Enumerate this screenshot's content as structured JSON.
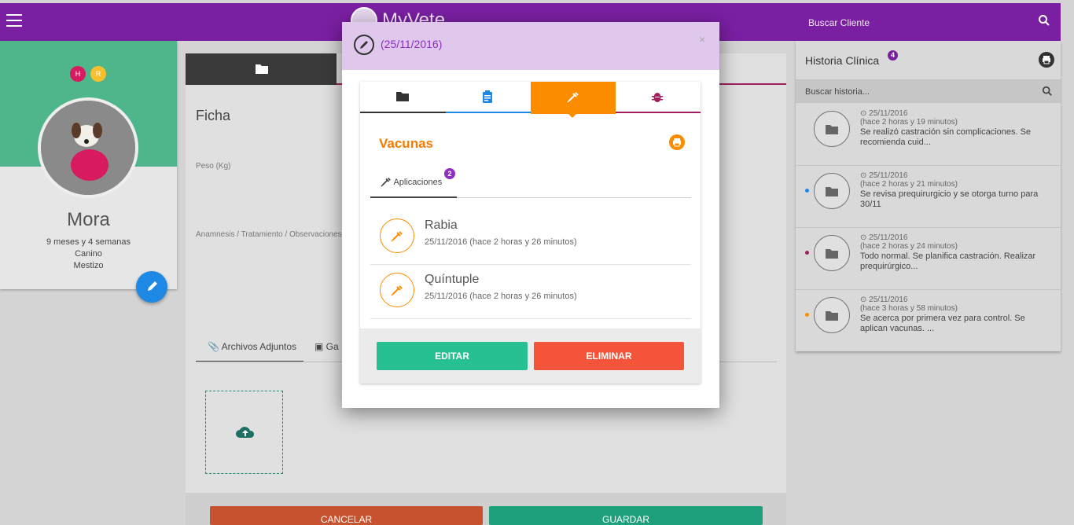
{
  "app": {
    "title": "MyVete",
    "accent": "#7a1fa2"
  },
  "search": {
    "placeholder": "Buscar Cliente"
  },
  "patient": {
    "tags": [
      "H",
      "R"
    ],
    "name": "Mora",
    "age": "9 meses y 4 semanas",
    "species": "Canino",
    "breed": "Mestizo"
  },
  "form": {
    "title": "Ficha",
    "peso_label": "Peso (Kg)",
    "anamnesis_label": "Anamnesis / Tratamiento / Observaciones",
    "tabs": {
      "adjuntos": "Archivos Adjuntos",
      "galeria": "Ga"
    },
    "cancel_label": "CANCELAR",
    "save_label": "GUARDAR"
  },
  "historia": {
    "title": "Historia Clínica",
    "count": "4",
    "search_placeholder": "Buscar historia...",
    "entries": [
      {
        "date": "25/11/2016",
        "ago": "(hace 2 horas y 19 minutos)",
        "text": "Se realizó castración sin complicaciones. Se recomienda cuid...",
        "dot": ""
      },
      {
        "date": "25/11/2016",
        "ago": "(hace 2 horas y 21 minutos)",
        "text": "Se revisa prequirurgicio y se otorga turno para 30/11",
        "dot": "#1e88e5"
      },
      {
        "date": "25/11/2016",
        "ago": "(hace 2 horas y 24 minutos)",
        "text": "Todo normal. Se planifica castración. Realizar prequirúrgico...",
        "dot": "#a0205f"
      },
      {
        "date": "25/11/2016",
        "ago": "(hace 3 horas y 58 minutos)",
        "text": "Se acerca por primera vez para control. Se aplican vacunas. ...",
        "dot": "#fb8c00"
      }
    ]
  },
  "modal": {
    "title": "(25/11/2016)",
    "close": "×",
    "section_title": "Vacunas",
    "tab_apps": "Aplicaciones",
    "apps_count": "2",
    "vacunas": [
      {
        "name": "Rabia",
        "date": "25/11/2016 (hace 2 horas y 26 minutos)"
      },
      {
        "name": "Quíntuple",
        "date": "25/11/2016 (hace 2 horas y 26 minutos)"
      }
    ],
    "edit_label": "EDITAR",
    "delete_label": "ELIMINAR"
  }
}
